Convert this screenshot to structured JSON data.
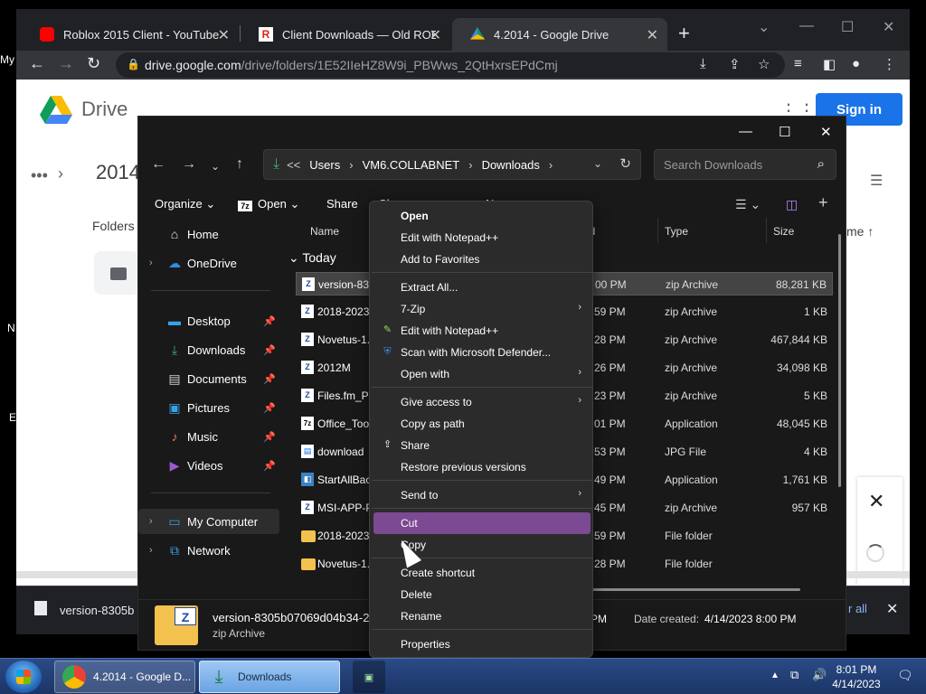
{
  "browser": {
    "tabs": [
      {
        "title": "Roblox 2015 Client - YouTube",
        "icon": "youtube-icon"
      },
      {
        "title": "Client Downloads — Old ROBLOX",
        "icon": "roblox-icon"
      },
      {
        "title": "4.2014 - Google Drive",
        "icon": "google-drive-icon"
      }
    ],
    "url_host": "drive.google.com",
    "url_path": "/drive/folders/1E52IIeHZ8W9i_PBWws_2QtHxrsEPdCmj"
  },
  "drive": {
    "logo_text": "Drive",
    "signin_label": "Sign in",
    "breadcrumb": "2014",
    "folders_label": "Folders",
    "sort_label": "me"
  },
  "shelf": {
    "filename": "version-8305b",
    "show_all": "r all"
  },
  "explorer": {
    "address": {
      "segments": [
        "Users",
        "VM6.COLLABNET",
        "Downloads"
      ],
      "overflow": "<<"
    },
    "search_placeholder": "Search Downloads",
    "toolbar": {
      "organize": "Organize",
      "open": "Open",
      "share": "Share",
      "truncated1": "Sh",
      "truncated2": "Ne"
    },
    "sidebar": {
      "home": "Home",
      "onedrive": "OneDrive",
      "desktop": "Desktop",
      "downloads": "Downloads",
      "documents": "Documents",
      "pictures": "Pictures",
      "music": "Music",
      "videos": "Videos",
      "mycomputer": "My Computer",
      "network": "Network"
    },
    "columns": {
      "name": "Name",
      "date_tail": "ed",
      "type": "Type",
      "size": "Size"
    },
    "group": "Today",
    "rows": [
      {
        "name": "version-830",
        "date": "00 PM",
        "type": "zip Archive",
        "size": "88,281 KB",
        "icon": "zip"
      },
      {
        "name": "2018-20230",
        "date": "59 PM",
        "type": "zip Archive",
        "size": "1 KB",
        "icon": "zip"
      },
      {
        "name": "Novetus-1.",
        "date": "28 PM",
        "type": "zip Archive",
        "size": "467,844 KB",
        "icon": "zip"
      },
      {
        "name": "2012M",
        "date": "26 PM",
        "type": "zip Archive",
        "size": "34,098 KB",
        "icon": "zip"
      },
      {
        "name": "Files.fm_Pa",
        "date": "23 PM",
        "type": "zip Archive",
        "size": "5 KB",
        "icon": "zip"
      },
      {
        "name": "Office_Tool",
        "date": "01 PM",
        "type": "Application",
        "size": "48,045 KB",
        "icon": "app7"
      },
      {
        "name": "download",
        "date": "53 PM",
        "type": "JPG File",
        "size": "4 KB",
        "icon": "doc"
      },
      {
        "name": "StartAllBac",
        "date": "49 PM",
        "type": "Application",
        "size": "1,761 KB",
        "icon": "appb"
      },
      {
        "name": "MSI-APP-P",
        "date": "45 PM",
        "type": "zip Archive",
        "size": "957 KB",
        "icon": "zip"
      },
      {
        "name": "2018-20230",
        "date": "59 PM",
        "type": "File folder",
        "size": "",
        "icon": "folder"
      },
      {
        "name": "Novetus-1.",
        "date": "28 PM",
        "type": "File folder",
        "size": "",
        "icon": "folder"
      }
    ],
    "details": {
      "name": "version-8305b07069d04b34-2",
      "type": "zip Archive",
      "pm_tail": "PM",
      "created_label": "Date created:",
      "created_value": "4/14/2023 8:00 PM"
    }
  },
  "context_menu": {
    "items": [
      {
        "label": "Open",
        "bold": true
      },
      {
        "label": "Edit with Notepad++"
      },
      {
        "label": "Add to Favorites"
      },
      {
        "label": "Extract All..."
      },
      {
        "label": "7-Zip",
        "submenu": true
      },
      {
        "label": "Edit with Notepad++",
        "icon": "notepadpp-icon"
      },
      {
        "label": "Scan with Microsoft Defender...",
        "icon": "defender-shield-icon"
      },
      {
        "label": "Open with",
        "submenu": true
      },
      {
        "label": "Give access to",
        "submenu": true
      },
      {
        "label": "Copy as path"
      },
      {
        "label": "Share",
        "icon": "share-icon"
      },
      {
        "label": "Restore previous versions"
      },
      {
        "label": "Send to",
        "submenu": true
      },
      {
        "label": "Cut",
        "highlight": true
      },
      {
        "label": "Copy"
      },
      {
        "label": "Create shortcut"
      },
      {
        "label": "Delete"
      },
      {
        "label": "Rename"
      },
      {
        "label": "Properties"
      }
    ]
  },
  "desktop_labels": [
    "My",
    "N",
    "E"
  ],
  "taskbar": {
    "chrome_label": "4.2014 - Google D...",
    "downloads_label": "Downloads",
    "time": "8:01 PM",
    "date": "4/14/2023"
  }
}
